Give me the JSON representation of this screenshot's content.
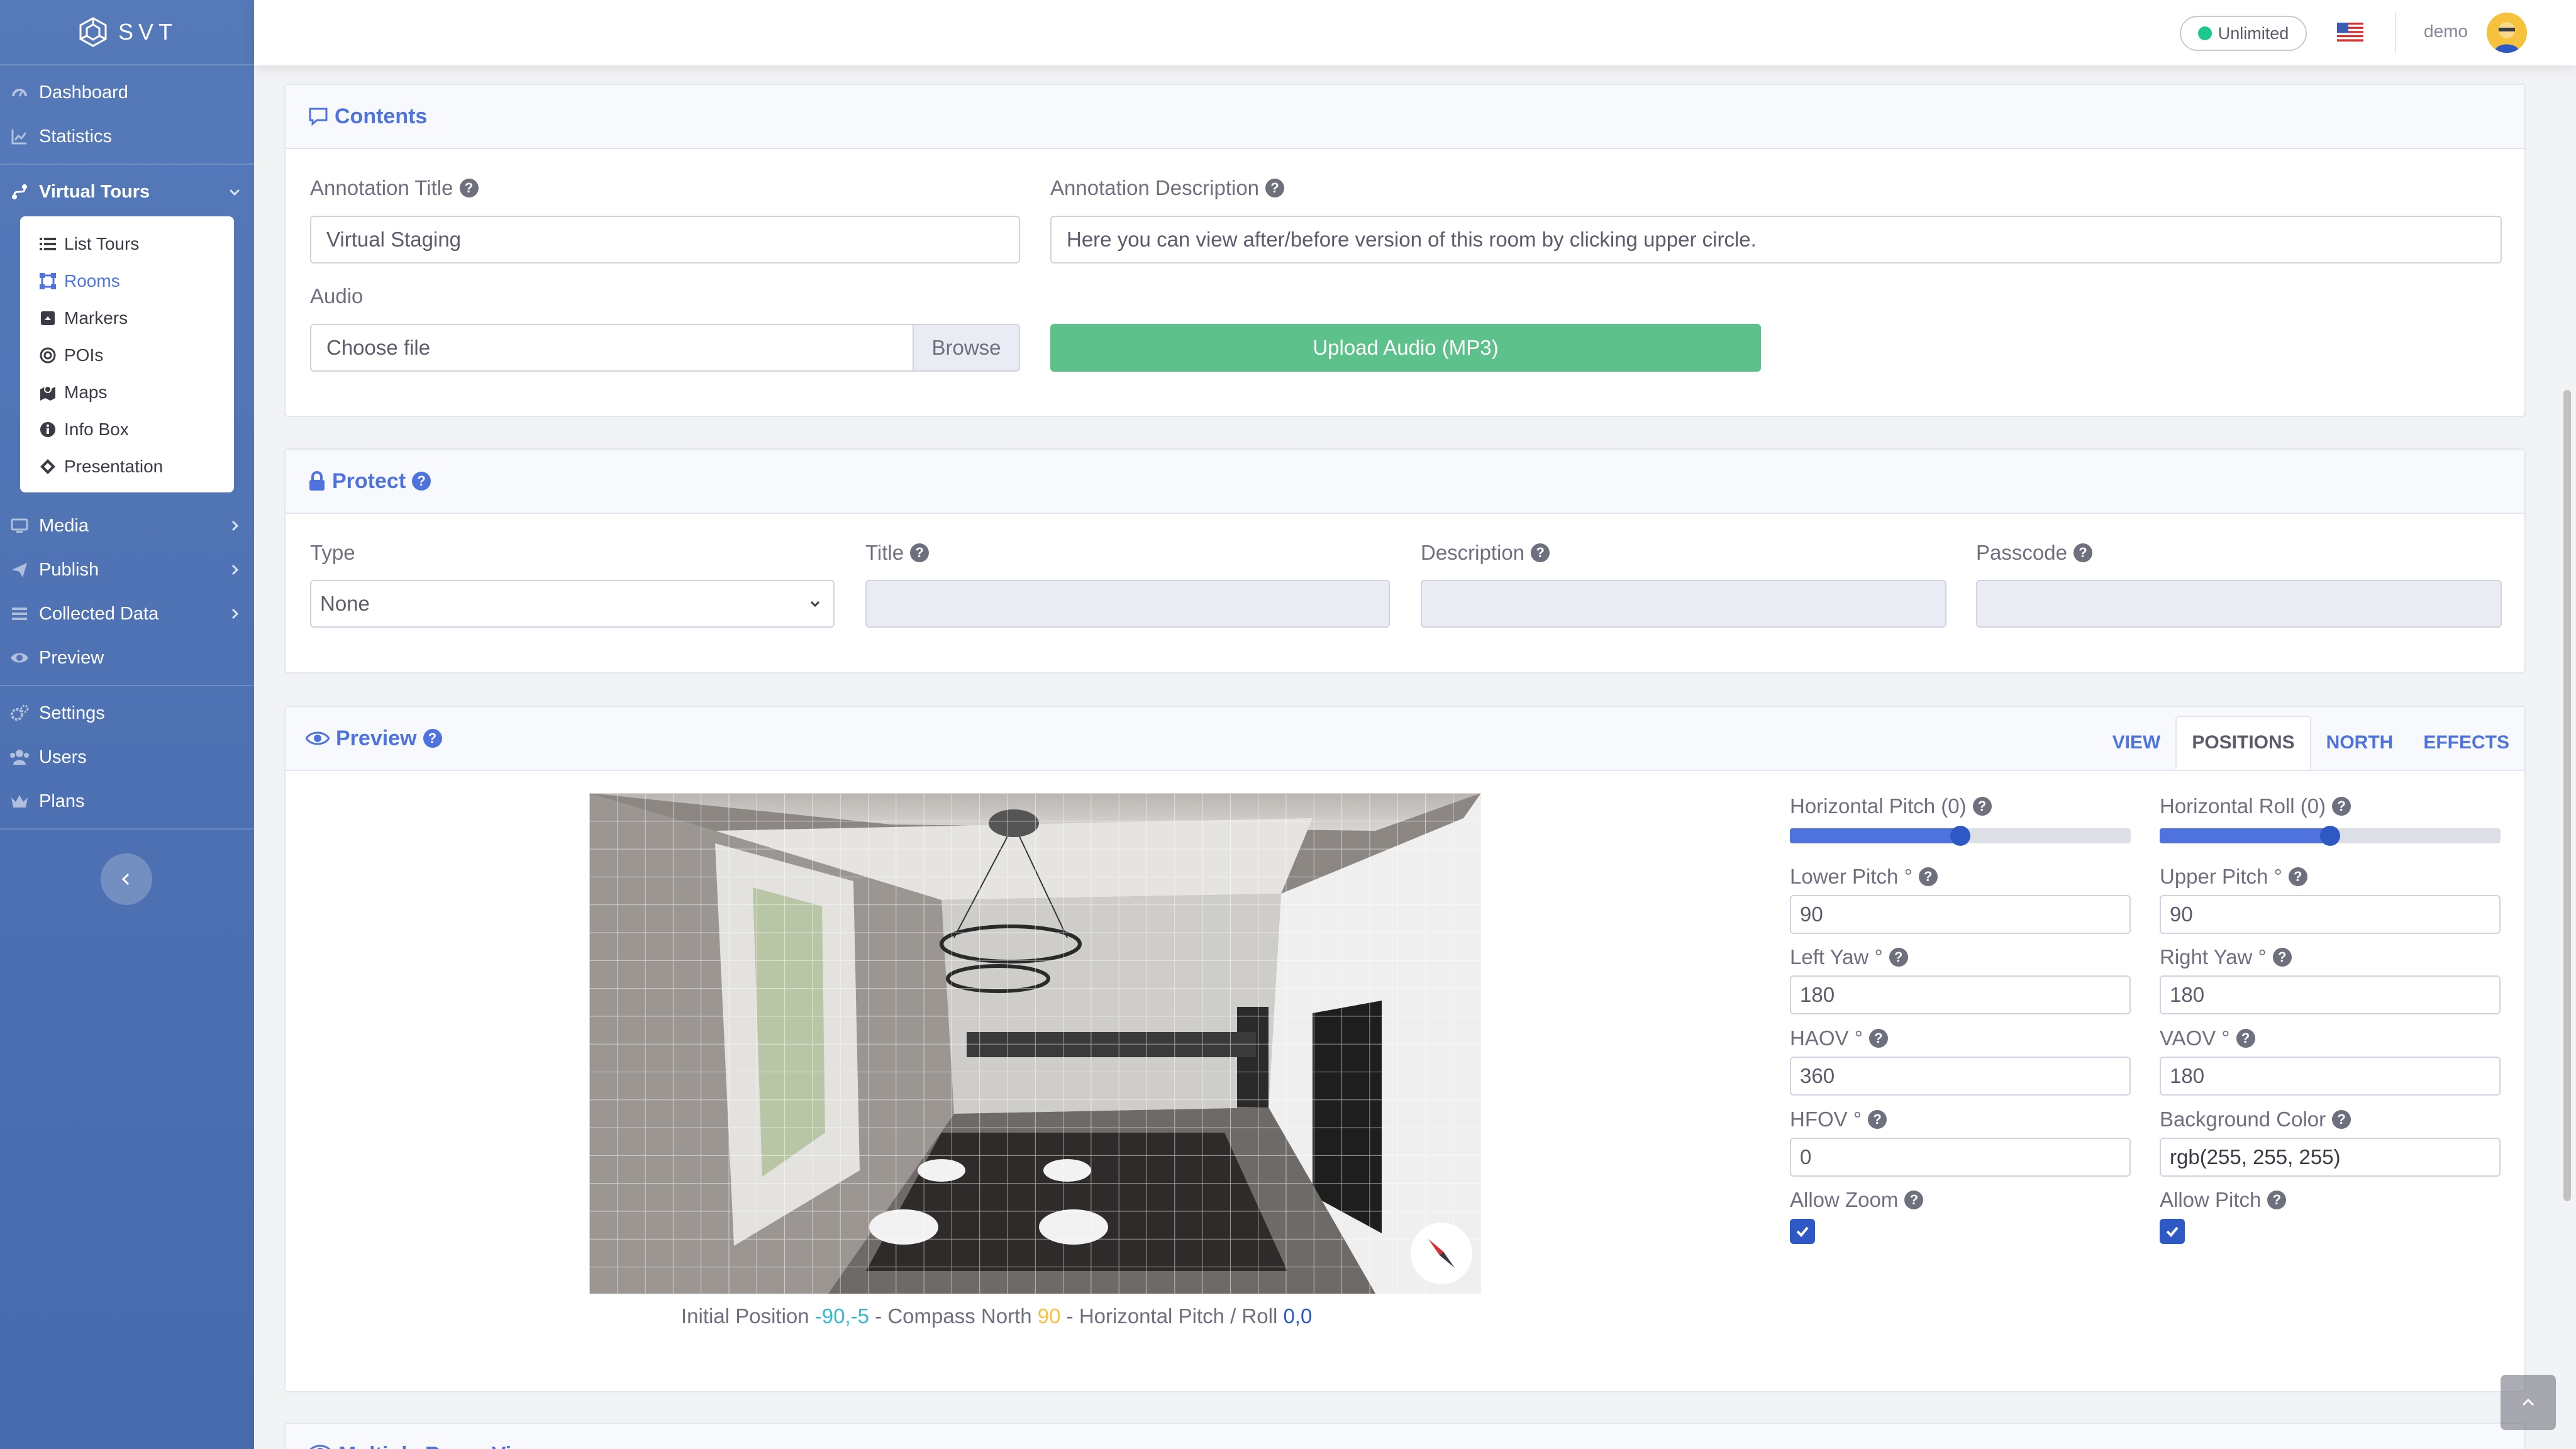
{
  "brand": {
    "name": "SVT",
    "logo_icon": "svt-logo-icon"
  },
  "sidebar": {
    "items": [
      {
        "label": "Dashboard",
        "icon": "dashboard-icon"
      },
      {
        "label": "Statistics",
        "icon": "chart-icon"
      },
      {
        "label": "Virtual Tours",
        "icon": "route-icon",
        "expanded": true
      },
      {
        "label": "Media",
        "icon": "monitor-icon"
      },
      {
        "label": "Publish",
        "icon": "send-icon"
      },
      {
        "label": "Collected Data",
        "icon": "list-icon"
      },
      {
        "label": "Preview",
        "icon": "eye-icon"
      },
      {
        "label": "Settings",
        "icon": "gears-icon"
      },
      {
        "label": "Users",
        "icon": "users-icon"
      },
      {
        "label": "Plans",
        "icon": "crown-icon"
      }
    ],
    "submenu": [
      {
        "label": "List Tours",
        "icon": "list-icon"
      },
      {
        "label": "Rooms",
        "icon": "vector-square-icon",
        "active": true
      },
      {
        "label": "Markers",
        "icon": "caret-square-icon"
      },
      {
        "label": "POIs",
        "icon": "bullseye-icon"
      },
      {
        "label": "Maps",
        "icon": "map-icon"
      },
      {
        "label": "Info Box",
        "icon": "info-circle-icon"
      },
      {
        "label": "Presentation",
        "icon": "diamond-icon"
      }
    ]
  },
  "topbar": {
    "plan": "Unlimited",
    "plan_color": "#1cc88a",
    "language_flag": "us-flag-icon",
    "username": "demo"
  },
  "contents": {
    "title": "Contents",
    "annotation_title_label": "Annotation Title",
    "annotation_title_value": "Virtual Staging",
    "annotation_desc_label": "Annotation Description",
    "annotation_desc_value": "Here you can view after/before version of this room by clicking upper circle.",
    "audio_label": "Audio",
    "file_placeholder": "Choose file",
    "browse_label": "Browse",
    "upload_button": "Upload Audio (MP3)"
  },
  "protect": {
    "title": "Protect",
    "type_label": "Type",
    "type_value": "None",
    "title_label": "Title",
    "description_label": "Description",
    "passcode_label": "Passcode"
  },
  "preview": {
    "title": "Preview",
    "tabs": [
      "VIEW",
      "POSITIONS",
      "NORTH",
      "EFFECTS"
    ],
    "active_tab": "POSITIONS",
    "caption": {
      "initial_label": "Initial Position",
      "initial_value": "-90,-5",
      "compass_label": "Compass North",
      "compass_value": "90",
      "pitch_roll_label": "Horizontal Pitch / Roll",
      "pitch_roll_value": "0,0",
      "sep": "-"
    },
    "horizontal_pitch_label": "Horizontal Pitch (0)",
    "horizontal_pitch_value": 0.5,
    "horizontal_roll_label": "Horizontal Roll (0)",
    "horizontal_roll_value": 0.5,
    "lower_pitch_label": "Lower Pitch °",
    "lower_pitch_value": "90",
    "upper_pitch_label": "Upper Pitch °",
    "upper_pitch_value": "90",
    "left_yaw_label": "Left Yaw °",
    "left_yaw_value": "180",
    "right_yaw_label": "Right Yaw °",
    "right_yaw_value": "180",
    "haov_label": "HAOV °",
    "haov_value": "360",
    "vaov_label": "VAOV °",
    "vaov_value": "180",
    "hfov_label": "HFOV °",
    "hfov_value": "0",
    "bg_color_label": "Background Color",
    "bg_color_value": "rgb(255, 255, 255)",
    "allow_zoom_label": "Allow Zoom",
    "allow_zoom_checked": true,
    "allow_pitch_label": "Allow Pitch",
    "allow_pitch_checked": true
  },
  "next_card_title": "Multiple Room View"
}
